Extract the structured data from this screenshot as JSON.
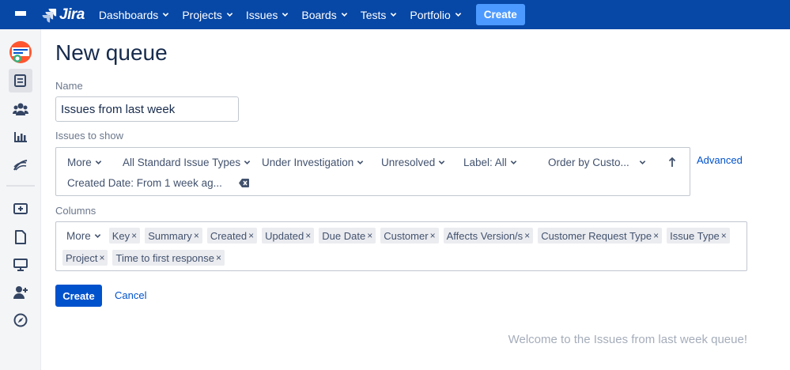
{
  "topbar": {
    "logo_text": "Jira",
    "nav": [
      "Dashboards",
      "Projects",
      "Issues",
      "Boards",
      "Tests",
      "Portfolio"
    ],
    "create_label": "Create",
    "color": "#0747a6",
    "create_color": "#4c9aff"
  },
  "sidebar": {
    "icons": [
      "project-avatar-icon",
      "queues-icon",
      "customers-icon",
      "reports-icon",
      "sla-icon",
      "add-item-icon",
      "page-icon",
      "channels-icon",
      "invite-team-icon",
      "compass-icon"
    ]
  },
  "page": {
    "title": "New queue",
    "name_label": "Name",
    "name_value": "Issues from last week",
    "issues_label": "Issues to show",
    "filters": {
      "more": "More",
      "issue_types": "All Standard Issue Types",
      "status": "Under Investigation",
      "resolution": "Unresolved",
      "label": "Label: All",
      "order": "Order by Custo...",
      "created": "Created Date: From 1 week ag..."
    },
    "advanced_label": "Advanced",
    "columns_label": "Columns",
    "columns_more": "More",
    "columns_row1": [
      "Key",
      "Summary",
      "Created",
      "Updated",
      "Due Date",
      "Customer",
      "Affects Version/s",
      "Customer Request Type",
      "Issue Type"
    ],
    "columns_row2": [
      "Project",
      "Time to first response"
    ],
    "create_button": "Create",
    "cancel_button": "Cancel",
    "welcome": "Welcome to the Issues from last week queue!"
  }
}
